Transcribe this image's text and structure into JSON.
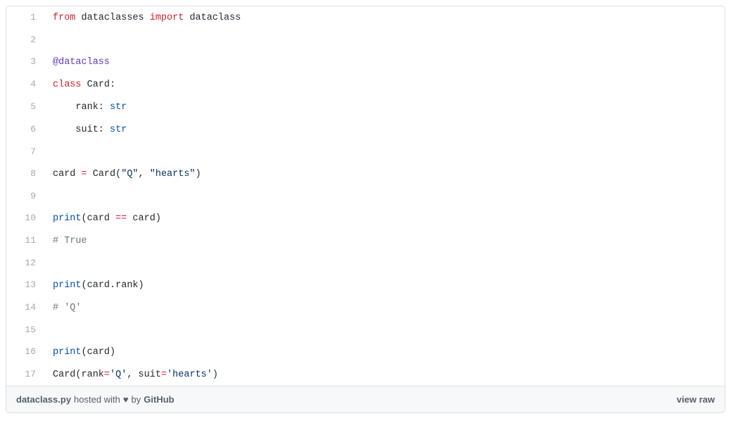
{
  "gist": {
    "filename": "dataclass.py",
    "hosted_text": " hosted with ",
    "heart_glyph": "♥",
    "by_text": " by ",
    "host": "GitHub",
    "view_raw": "view raw",
    "lines": [
      {
        "n": "1",
        "tokens": [
          {
            "t": "from",
            "c": "tk-kw"
          },
          {
            "t": " dataclasses ",
            "c": "tk-name"
          },
          {
            "t": "import",
            "c": "tk-kw"
          },
          {
            "t": " dataclass",
            "c": "tk-name"
          }
        ]
      },
      {
        "n": "2",
        "tokens": []
      },
      {
        "n": "3",
        "tokens": [
          {
            "t": "@dataclass",
            "c": "tk-dec"
          }
        ]
      },
      {
        "n": "4",
        "tokens": [
          {
            "t": "class",
            "c": "tk-kw"
          },
          {
            "t": " ",
            "c": "tk-name"
          },
          {
            "t": "Card",
            "c": "tk-name"
          },
          {
            "t": ":",
            "c": "tk-punct"
          }
        ]
      },
      {
        "n": "5",
        "tokens": [
          {
            "t": "    rank: ",
            "c": "tk-name"
          },
          {
            "t": "str",
            "c": "tk-builtin"
          }
        ]
      },
      {
        "n": "6",
        "tokens": [
          {
            "t": "    suit: ",
            "c": "tk-name"
          },
          {
            "t": "str",
            "c": "tk-builtin"
          }
        ]
      },
      {
        "n": "7",
        "tokens": []
      },
      {
        "n": "8",
        "tokens": [
          {
            "t": "card ",
            "c": "tk-name"
          },
          {
            "t": "=",
            "c": "tk-op"
          },
          {
            "t": " Card(",
            "c": "tk-name"
          },
          {
            "t": "\"Q\"",
            "c": "tk-str"
          },
          {
            "t": ", ",
            "c": "tk-punct"
          },
          {
            "t": "\"hearts\"",
            "c": "tk-str"
          },
          {
            "t": ")",
            "c": "tk-punct"
          }
        ]
      },
      {
        "n": "9",
        "tokens": []
      },
      {
        "n": "10",
        "tokens": [
          {
            "t": "print",
            "c": "tk-builtin"
          },
          {
            "t": "(card ",
            "c": "tk-name"
          },
          {
            "t": "==",
            "c": "tk-op"
          },
          {
            "t": " card)",
            "c": "tk-name"
          }
        ]
      },
      {
        "n": "11",
        "tokens": [
          {
            "t": "# True",
            "c": "tk-comment"
          }
        ]
      },
      {
        "n": "12",
        "tokens": []
      },
      {
        "n": "13",
        "tokens": [
          {
            "t": "print",
            "c": "tk-builtin"
          },
          {
            "t": "(card.rank)",
            "c": "tk-name"
          }
        ]
      },
      {
        "n": "14",
        "tokens": [
          {
            "t": "# 'Q'",
            "c": "tk-comment"
          }
        ]
      },
      {
        "n": "15",
        "tokens": []
      },
      {
        "n": "16",
        "tokens": [
          {
            "t": "print",
            "c": "tk-builtin"
          },
          {
            "t": "(card)",
            "c": "tk-name"
          }
        ]
      },
      {
        "n": "17",
        "tokens": [
          {
            "t": "Card(rank",
            "c": "tk-name"
          },
          {
            "t": "=",
            "c": "tk-op"
          },
          {
            "t": "'Q'",
            "c": "tk-str"
          },
          {
            "t": ", suit",
            "c": "tk-name"
          },
          {
            "t": "=",
            "c": "tk-op"
          },
          {
            "t": "'hearts'",
            "c": "tk-str"
          },
          {
            "t": ")",
            "c": "tk-punct"
          }
        ]
      }
    ]
  }
}
